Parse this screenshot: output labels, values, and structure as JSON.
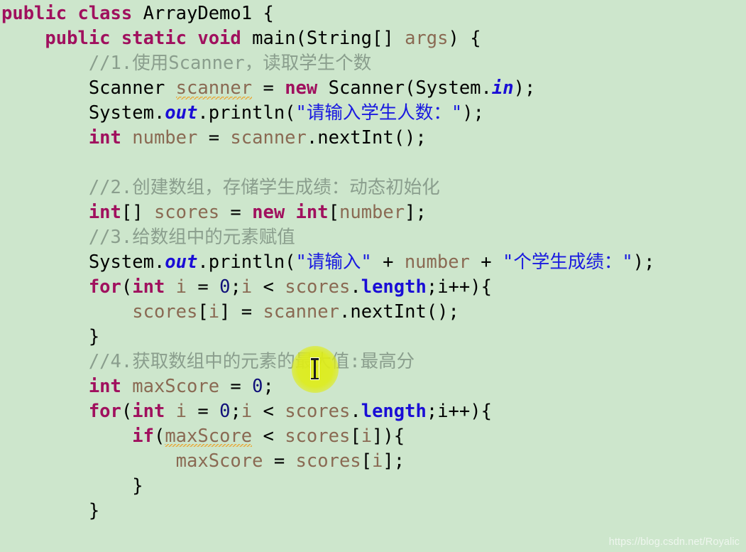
{
  "editor": {
    "background_color": "#cde6cc",
    "language": "Java",
    "class_name": "ArrayDemo1"
  },
  "colors": {
    "keyword": "#a0105e",
    "identifier": "#8a6a53",
    "static_field": "#1a0dd6",
    "string": "#1a1ae0",
    "number": "#10107a",
    "comment": "#8a9e8d",
    "plain_text": "#000000",
    "warning_squiggle": "#e8a93a",
    "click_highlight": "#deec1a",
    "watermark": "#eef6ee"
  },
  "code": {
    "line1": {
      "kw_public_class": "public class",
      "class_name": " ArrayDemo1 {"
    },
    "line2": {
      "indent": "    ",
      "kw": "public static void",
      "rest": " main(String[] ",
      "param": "args",
      "tail": ") {"
    },
    "line3": {
      "indent": "        ",
      "comment": "//1.使用Scanner，读取学生个数"
    },
    "line4": {
      "indent": "        ",
      "type": "Scanner ",
      "var": "scanner",
      "eq": " = ",
      "kw_new": "new",
      "ctor": " Scanner(System.",
      "field": "in",
      "tail": ");"
    },
    "line5": {
      "indent": "        ",
      "sys": "System.",
      "field": "out",
      "call": ".println(",
      "string": "\"请输入学生人数：\"",
      "tail": ");"
    },
    "line6": {
      "indent": "        ",
      "kw_int": "int",
      "var": " number",
      "eq": " = ",
      "expr": "scanner",
      "call": ".nextInt();"
    },
    "line7": {
      "text": ""
    },
    "line8": {
      "indent": "        ",
      "comment": "//2.创建数组，存储学生成绩：动态初始化"
    },
    "line9": {
      "indent": "        ",
      "kw_int": "int",
      "brackets": "[] ",
      "var": "scores",
      "eq": " = ",
      "kw_new": "new",
      "kw_int2": " int",
      "lb": "[",
      "var2": "number",
      "tail": "];"
    },
    "line10": {
      "indent": "        ",
      "comment": "//3.给数组中的元素赋值"
    },
    "line11": {
      "indent": "        ",
      "sys": "System.",
      "field": "out",
      "call": ".println(",
      "string1": "\"请输入\"",
      "plus1": " + ",
      "var": "number",
      "plus2": " + ",
      "string2": "\"个学生成绩：\"",
      "tail": ");"
    },
    "line12": {
      "indent": "        ",
      "kw_for": "for",
      "lp": "(",
      "kw_int": "int",
      "var_i": " i",
      "eq": " = ",
      "num": "0",
      "semi": ";",
      "var_i2": "i",
      "lt": " < ",
      "var_scores": "scores",
      "dot": ".",
      "length": "length",
      "tail": ";i++){"
    },
    "line13": {
      "indent": "            ",
      "var_scores": "scores",
      "lb": "[",
      "var_i": "i",
      "rb": "] ",
      "eq": "= ",
      "var_scanner": "scanner",
      "call": ".nextInt();"
    },
    "line14": {
      "indent": "        ",
      "brace": "}"
    },
    "line15": {
      "indent": "        ",
      "comment": "//4.获取数组中的元素的最大值:最高分"
    },
    "line16": {
      "indent": "        ",
      "kw_int": "int",
      "var": " maxScore",
      "eq": " = ",
      "num": "0",
      "tail": ";"
    },
    "line17": {
      "indent": "        ",
      "kw_for": "for",
      "lp": "(",
      "kw_int": "int",
      "var_i": " i",
      "eq": " = ",
      "num": "0",
      "semi": ";",
      "var_i2": "i",
      "lt": " < ",
      "var_scores": "scores",
      "dot": ".",
      "length": "length",
      "tail": ";i++){"
    },
    "line18": {
      "indent": "            ",
      "kw_if": "if",
      "lp": "(",
      "var_max": "maxScore",
      "lt": " < ",
      "var_scores": "scores",
      "lb": "[",
      "var_i": "i",
      "tail": "]){"
    },
    "line19": {
      "indent": "                ",
      "var_max": "maxScore",
      "eq": " = ",
      "var_scores": "scores",
      "lb": "[",
      "var_i": "i",
      "tail": "];"
    },
    "line20": {
      "indent": "            ",
      "brace": "}"
    },
    "line21": {
      "indent": "        ",
      "brace": "}"
    }
  },
  "overlay": {
    "click_highlight_label": "click-highlight",
    "cursor_label": "text-cursor-ibeam",
    "watermark": "https://blog.csdn.net/Royalic"
  }
}
